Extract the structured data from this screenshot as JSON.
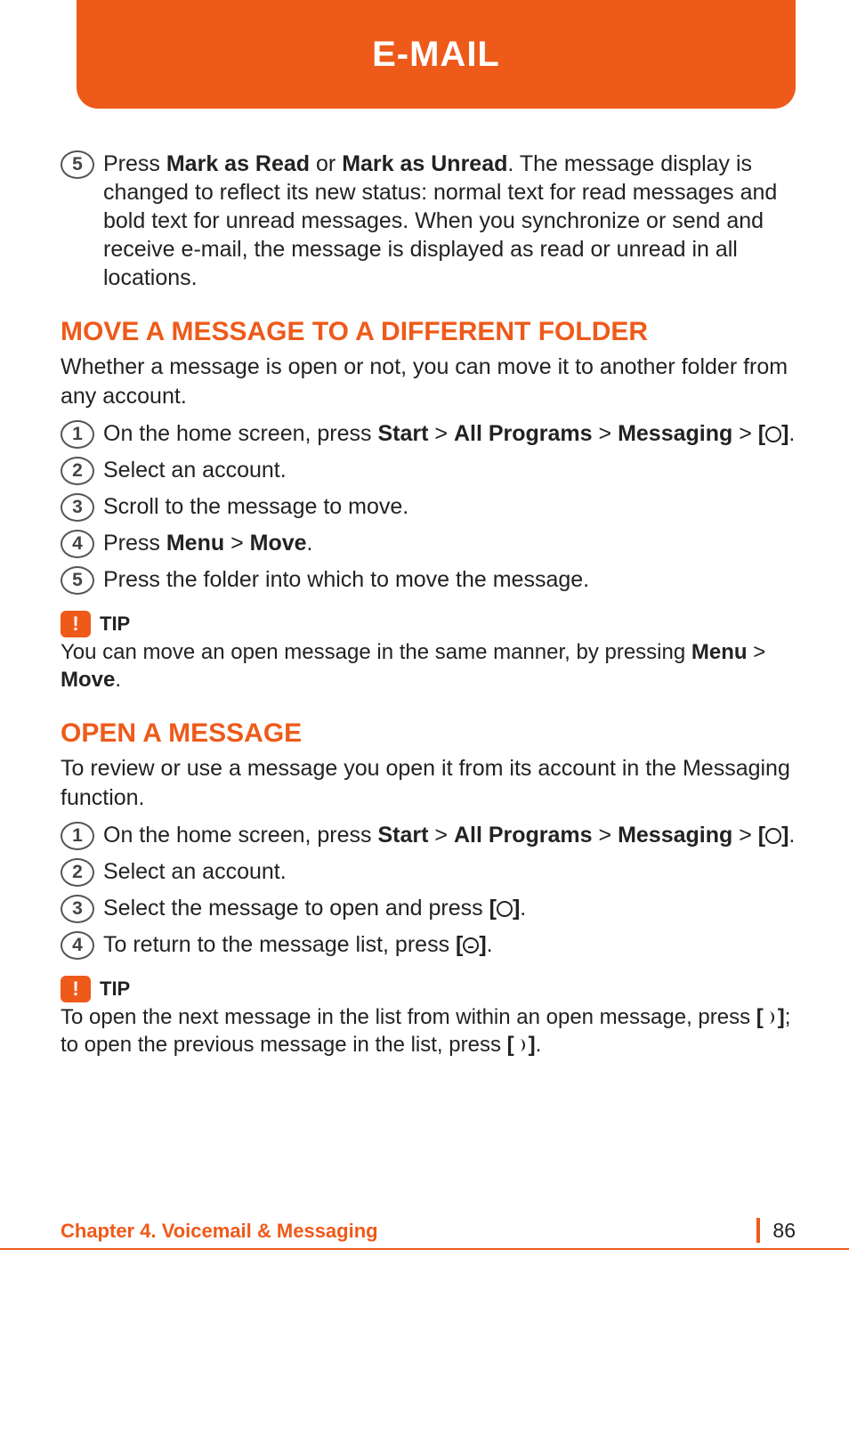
{
  "header": {
    "title": "E-MAIL"
  },
  "intro_step": {
    "num": "5",
    "pre": "Press ",
    "b1": "Mark as Read",
    "mid": " or ",
    "b2": "Mark as Unread",
    "post": ". The message display is changed to reflect its new status: normal text for read messages and bold text for unread messages. When you synchronize or send and receive e-mail, the message is displayed as read or unread in all locations."
  },
  "section_move": {
    "title": "MOVE A MESSAGE TO A DIFFERENT FOLDER",
    "intro": "Whether a message is open or not, you can move it to another folder from any account.",
    "steps": {
      "s1": {
        "num": "1",
        "pre": "On the home screen, press ",
        "b1": "Start",
        "g1": " > ",
        "b2": "All Programs",
        "g2": " > ",
        "b3": "Messaging",
        "g3": " > ",
        "br_open": "[",
        "br_close": "]",
        "post": "."
      },
      "s2": {
        "num": "2",
        "text": "Select an account."
      },
      "s3": {
        "num": "3",
        "text": "Scroll to the message to move."
      },
      "s4": {
        "num": "4",
        "pre": "Press ",
        "b1": "Menu",
        "g1": " > ",
        "b2": "Move",
        "post": "."
      },
      "s5": {
        "num": "5",
        "text": "Press the folder into which to move the message."
      }
    },
    "tip": {
      "label": "TIP",
      "pre": "You can move an open message in the same manner, by pressing ",
      "b1": "Menu",
      "g1": " > ",
      "b2": "Move",
      "post": "."
    }
  },
  "section_open": {
    "title": "OPEN A MESSAGE",
    "intro": "To review or use a message you open it from its account in the Messaging function.",
    "steps": {
      "s1": {
        "num": "1",
        "pre": "On the home screen, press ",
        "b1": "Start",
        "g1": " > ",
        "b2": "All Programs",
        "g2": " > ",
        "b3": "Messaging",
        "g3": " > ",
        "br_open": "[",
        "br_close": "]",
        "post": "."
      },
      "s2": {
        "num": "2",
        "text": "Select an account."
      },
      "s3": {
        "num": "3",
        "pre": "Select the message to open and press ",
        "br_open": "[",
        "br_close": "]",
        "post": "."
      },
      "s4": {
        "num": "4",
        "pre": "To return to the message list, press ",
        "br_open": "[",
        "br_close": "]",
        "post": "."
      }
    },
    "tip": {
      "label": "TIP",
      "pre": "To open the next message in the list from within an open message, press ",
      "br1o": "[",
      "br1c": "]",
      "mid": "; to open the previous message in the list, press ",
      "br2o": "[",
      "br2c": "]",
      "post": "."
    }
  },
  "footer": {
    "chapter": "Chapter 4. Voicemail & Messaging",
    "page": "86"
  }
}
